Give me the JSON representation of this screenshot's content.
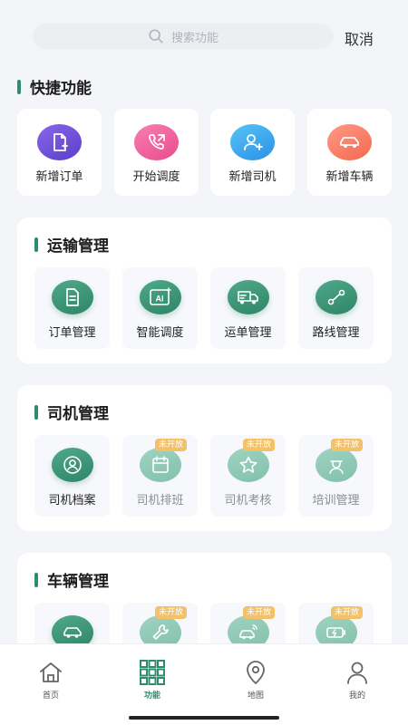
{
  "search": {
    "placeholder": "搜索功能",
    "cancel_label": "取消"
  },
  "quick": {
    "title": "快捷功能",
    "items": [
      {
        "label": "新增订单",
        "icon": "new-order-icon",
        "colors": [
          "#8a66e8",
          "#5a3fc9"
        ]
      },
      {
        "label": "开始调度",
        "icon": "phone-icon",
        "colors": [
          "#f77fb3",
          "#e94c8d"
        ]
      },
      {
        "label": "新增司机",
        "icon": "add-driver-icon",
        "colors": [
          "#56c4f7",
          "#2d90e6"
        ]
      },
      {
        "label": "新增车辆",
        "icon": "car-icon",
        "colors": [
          "#ff9a86",
          "#f5684f"
        ]
      }
    ]
  },
  "transport": {
    "title": "运输管理",
    "items": [
      {
        "label": "订单管理",
        "icon": "document-icon"
      },
      {
        "label": "智能调度",
        "icon": "ai-icon"
      },
      {
        "label": "运单管理",
        "icon": "truck-icon"
      },
      {
        "label": "路线管理",
        "icon": "route-icon"
      }
    ]
  },
  "driver": {
    "title": "司机管理",
    "items": [
      {
        "label": "司机档案",
        "icon": "user-profile-icon"
      },
      {
        "label": "司机排班",
        "icon": "calendar-icon",
        "badge": "未开放"
      },
      {
        "label": "司机考核",
        "icon": "star-icon",
        "badge": "未开放"
      },
      {
        "label": "培训管理",
        "icon": "trainer-icon",
        "badge": "未开放"
      }
    ]
  },
  "vehicle": {
    "title": "车辆管理",
    "items": [
      {
        "label": "",
        "icon": "car-icon"
      },
      {
        "label": "",
        "icon": "wrench-icon",
        "badge": "未开放"
      },
      {
        "label": "",
        "icon": "car-signal-icon",
        "badge": "未开放"
      },
      {
        "label": "",
        "icon": "battery-charge-icon",
        "badge": "未开放"
      }
    ]
  },
  "tabs": [
    {
      "label": "首页",
      "icon": "home-icon"
    },
    {
      "label": "功能",
      "icon": "grid-icon"
    },
    {
      "label": "地图",
      "icon": "map-pin-icon"
    },
    {
      "label": "我的",
      "icon": "person-icon"
    }
  ],
  "colors": {
    "accent": "#2f8c6c",
    "badge": "#f2c16a",
    "background": "#f3f5f8"
  }
}
